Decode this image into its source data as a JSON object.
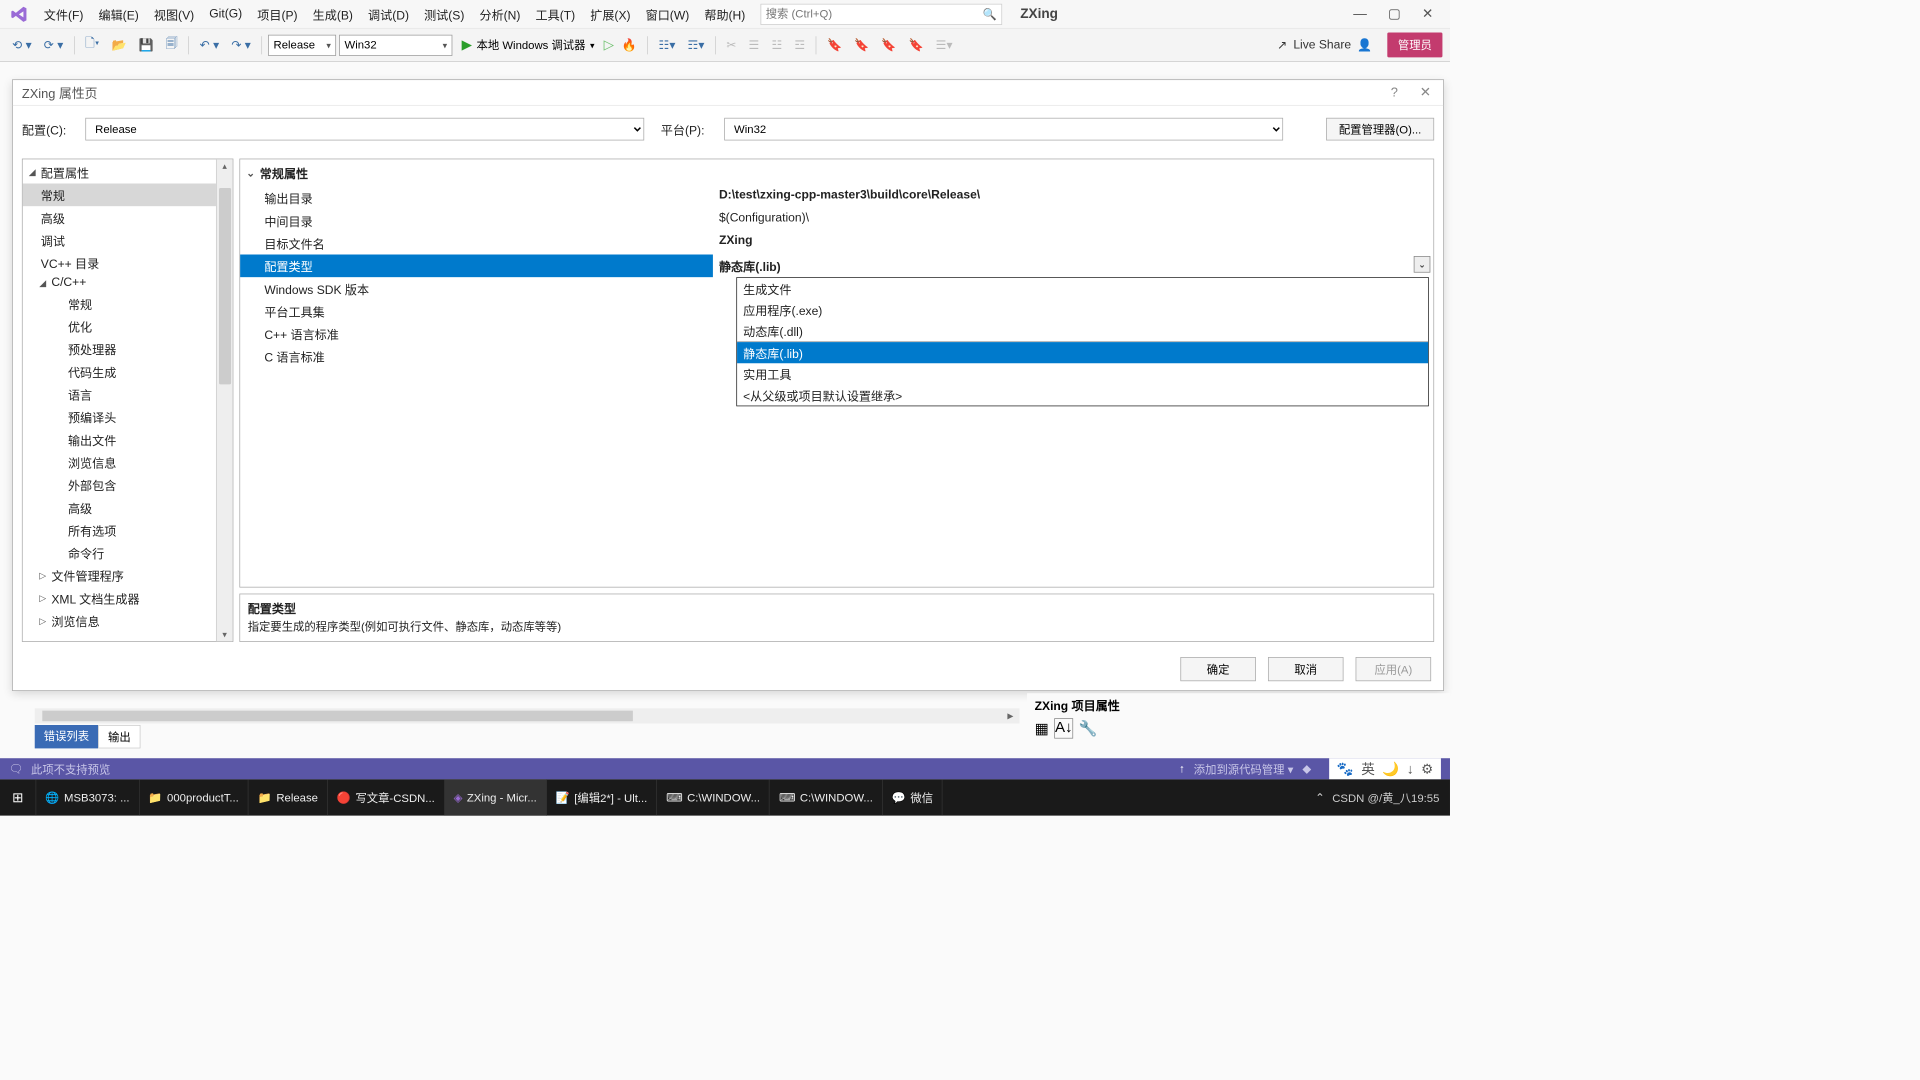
{
  "menu": {
    "items": [
      "文件(F)",
      "编辑(E)",
      "视图(V)",
      "Git(G)",
      "项目(P)",
      "生成(B)",
      "调试(D)",
      "测试(S)",
      "分析(N)",
      "工具(T)",
      "扩展(X)",
      "窗口(W)",
      "帮助(H)"
    ],
    "search_placeholder": "搜索 (Ctrl+Q)",
    "solution_name": "ZXing"
  },
  "toolbar": {
    "config": "Release",
    "platform": "Win32",
    "debugger": "本地 Windows 调试器",
    "live_share": "Live Share",
    "admin": "管理员"
  },
  "dialog": {
    "title": "ZXing 属性页",
    "cfg_label": "配置(C):",
    "cfg_value": "Release",
    "plat_label": "平台(P):",
    "plat_value": "Win32",
    "cfg_mgr": "配置管理器(O)..."
  },
  "tree": {
    "root": "配置属性",
    "items": [
      "常规",
      "高级",
      "调试",
      "VC++ 目录"
    ],
    "ccpp": "C/C++",
    "ccpp_items": [
      "常规",
      "优化",
      "预处理器",
      "代码生成",
      "语言",
      "预编译头",
      "输出文件",
      "浏览信息",
      "外部包含",
      "高级",
      "所有选项",
      "命令行"
    ],
    "more": [
      "文件管理程序",
      "XML 文档生成器",
      "浏览信息"
    ]
  },
  "props": {
    "section": "常规属性",
    "rows": [
      {
        "name": "输出目录",
        "value": "D:\\test\\zxing-cpp-master3\\build\\core\\Release\\",
        "bold": true
      },
      {
        "name": "中间目录",
        "value": "$(Configuration)\\"
      },
      {
        "name": "目标文件名",
        "value": "ZXing",
        "bold": true
      },
      {
        "name": "配置类型",
        "value": "静态库(.lib)",
        "selected": true
      },
      {
        "name": "Windows SDK 版本",
        "value": ""
      },
      {
        "name": "平台工具集",
        "value": ""
      },
      {
        "name": "C++ 语言标准",
        "value": ""
      },
      {
        "name": "C 语言标准",
        "value": ""
      }
    ],
    "dropdown": [
      "生成文件",
      "应用程序(.exe)",
      "动态库(.dll)",
      "静态库(.lib)",
      "实用工具",
      "<从父级或项目默认设置继承>"
    ]
  },
  "desc": {
    "title": "配置类型",
    "text": "指定要生成的程序类型(例如可执行文件、静态库，动态库等等)"
  },
  "dlg_btns": {
    "ok": "确定",
    "cancel": "取消",
    "apply": "应用(A)"
  },
  "right_pane": {
    "title": "ZXing 项目属性"
  },
  "out_tabs": {
    "err": "错误列表",
    "out": "输出"
  },
  "status": {
    "text": "此项不支持预览",
    "src_ctrl": "添加到源代码管理 ▾"
  },
  "taskbar": {
    "items": [
      {
        "icon": "🪟",
        "label": ""
      },
      {
        "icon": "🌐",
        "label": "MSB3073:  ...",
        "color": "#2e83d6"
      },
      {
        "icon": "📁",
        "label": "000productT..."
      },
      {
        "icon": "📁",
        "label": "Release"
      },
      {
        "icon": "🔴",
        "label": "写文章-CSDN..."
      },
      {
        "icon": "◈",
        "label": "ZXing - Micr...",
        "color": "#7b6bbf"
      },
      {
        "icon": "📝",
        "label": "[编辑2*] - Ult...",
        "color": "#d88b2a"
      },
      {
        "icon": "⌨",
        "label": "C:\\WINDOW..."
      },
      {
        "icon": "⌨",
        "label": "C:\\WINDOW..."
      },
      {
        "icon": "💬",
        "label": "微信",
        "color": "#4bc24b"
      }
    ],
    "watermark": "CSDN @/黄_八19:55"
  }
}
